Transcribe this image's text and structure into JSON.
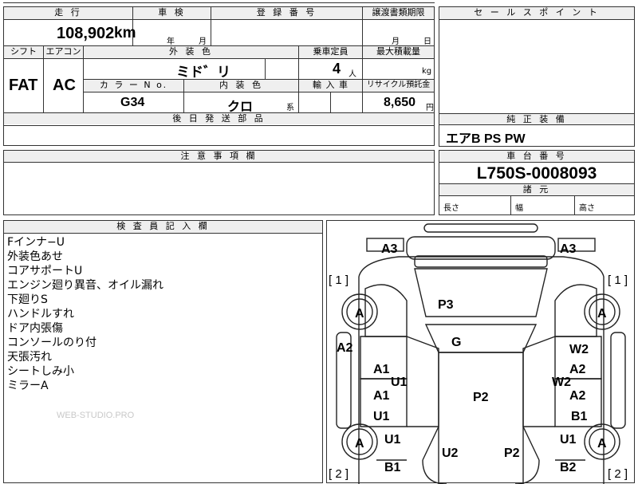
{
  "top": {
    "mileage_label": "走 行",
    "mileage_value": "108,902",
    "mileage_unit": "km",
    "inspection_label": "車 検",
    "year_unit": "年",
    "month_unit": "月",
    "reg_label": "登 録 番 号",
    "transfer_label": "譲渡書類期限",
    "transfer_month": "月",
    "transfer_day": "日"
  },
  "sales": {
    "title": "セ ー ル ス ポ イ ン ト"
  },
  "spec": {
    "shift_label": "シフト",
    "ac_label": "エアコン",
    "shift_value": "FAT",
    "ac_value": "AC",
    "ext_color_label": "外 装 色",
    "ext_color_value": "ミド゛リ",
    "capacity_label": "乗車定員",
    "capacity_value": "4",
    "capacity_unit": "人",
    "load_label": "最大積載量",
    "load_unit": "kg",
    "color_no_label": "カ ラ ー N o.",
    "color_no_value": "G34",
    "int_color_label": "内 装 色",
    "int_color_value": "クロ",
    "int_color_unit": "系",
    "import_label": "輸 入 車",
    "recycle_label": "リサイクル預託金",
    "recycle_value": "8,650",
    "recycle_unit": "円",
    "later_parts_label": "後 日 発 送 部 品"
  },
  "equip": {
    "title": "純 正 装 備",
    "value": "エアB PS PW"
  },
  "caution": {
    "title": "注 意 事 項 欄"
  },
  "chassis": {
    "title": "車 台 番 号",
    "value": "L750S-0008093",
    "dims_title": "諸 元",
    "length": "長さ",
    "width": "幅",
    "height": "高さ"
  },
  "inspector": {
    "title": "検 査 員 記 入 欄",
    "notes": [
      "Fインナ−U",
      "外装色あせ",
      "コアサポートU",
      "エンジン廻り異音、オイル漏れ",
      "下廻りS",
      "ハンドルすれ",
      "ドア内張傷",
      "コンソールのり付",
      "天張汚れ",
      "シートしみ小",
      "ミラーA"
    ],
    "watermark": "WEB-STUDIO.PRO"
  },
  "diagram": {
    "labels": {
      "a3_left": "A3",
      "a3_right": "A3",
      "tire_fl": "A",
      "tire_fr": "A",
      "tire_rl": "A",
      "tire_rr": "A",
      "br1_left": "[ 1 ]",
      "br1_right": "[ 1 ]",
      "br2_left": "[ 2 ]",
      "br2_right": "[ 2 ]",
      "p3": "P3",
      "g": "G",
      "p2_center": "P2",
      "a2_left": "A2",
      "w2_right": "W2",
      "a2_right1": "A2",
      "a1_left1": "A1",
      "u1_left1": "U1",
      "w2_right2": "W2",
      "a1_left2": "A1",
      "a2_right2": "A2",
      "u1_left2": "U1",
      "b1_right1": "B1",
      "u1_left3": "U1",
      "u1_right": "U1",
      "u2": "U2",
      "p2_bottom": "P2",
      "b1_left": "B1",
      "b2_right": "B2"
    }
  }
}
